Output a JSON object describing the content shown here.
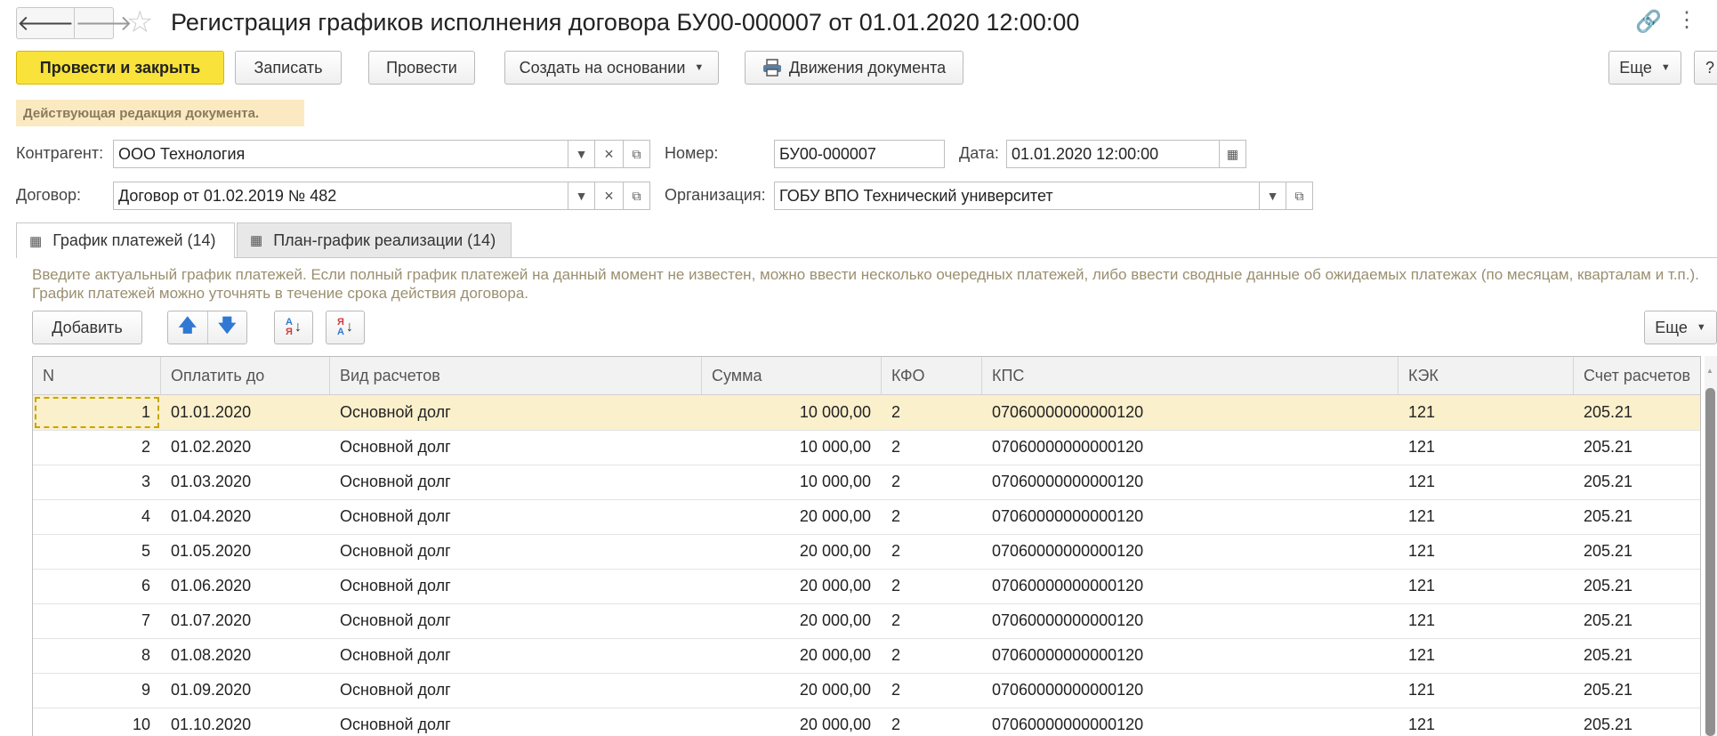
{
  "window": {
    "title": "Регистрация графиков исполнения договора БУ00-000007 от 01.01.2020 12:00:00",
    "back_icon": "arrow-left-icon",
    "forward_icon": "arrow-right-icon"
  },
  "toolbar": {
    "post_close": "Провести и закрыть",
    "save": "Записать",
    "post": "Провести",
    "create_based": "Создать на основании",
    "movements": "Движения документа",
    "more": "Еще",
    "help": "?"
  },
  "notice": "Действующая редакция документа.",
  "form": {
    "contractor_label": "Контрагент:",
    "contractor_value": "ООО Технология",
    "number_label": "Номер:",
    "number_value": "БУ00-000007",
    "date_label": "Дата:",
    "date_value": "01.01.2020 12:00:00",
    "contract_label": "Договор:",
    "contract_value": "Договор от 01.02.2019 № 482",
    "org_label": "Организация:",
    "org_value": "ГОБУ ВПО Технический университет"
  },
  "tabs": [
    {
      "label": "График платежей (14)"
    },
    {
      "label": "План-график реализации (14)"
    }
  ],
  "hint": "Введите актуальный график платежей. Если полный график платежей на данный момент не известен, можно ввести несколько очередных платежей, либо ввести сводные данные об ожидаемых платежах (по месяцам, кварталам и т.п.). График платежей можно уточнять в течение срока действия договора.",
  "table_toolbar": {
    "add": "Добавить",
    "more": "Еще",
    "sort_asc_top": "А",
    "sort_asc_bottom": "Я",
    "sort_desc_top": "Я",
    "sort_desc_bottom": "А"
  },
  "table": {
    "columns": [
      "N",
      "Оплатить до",
      "Вид расчетов",
      "Сумма",
      "КФО",
      "КПС",
      "КЭК",
      "Счет расчетов"
    ],
    "rows": [
      [
        "1",
        "01.01.2020",
        "Основной долг",
        "10 000,00",
        "2",
        "07060000000000120",
        "121",
        "205.21"
      ],
      [
        "2",
        "01.02.2020",
        "Основной долг",
        "10 000,00",
        "2",
        "07060000000000120",
        "121",
        "205.21"
      ],
      [
        "3",
        "01.03.2020",
        "Основной долг",
        "10 000,00",
        "2",
        "07060000000000120",
        "121",
        "205.21"
      ],
      [
        "4",
        "01.04.2020",
        "Основной долг",
        "20 000,00",
        "2",
        "07060000000000120",
        "121",
        "205.21"
      ],
      [
        "5",
        "01.05.2020",
        "Основной долг",
        "20 000,00",
        "2",
        "07060000000000120",
        "121",
        "205.21"
      ],
      [
        "6",
        "01.06.2020",
        "Основной долг",
        "20 000,00",
        "2",
        "07060000000000120",
        "121",
        "205.21"
      ],
      [
        "7",
        "01.07.2020",
        "Основной долг",
        "20 000,00",
        "2",
        "07060000000000120",
        "121",
        "205.21"
      ],
      [
        "8",
        "01.08.2020",
        "Основной долг",
        "20 000,00",
        "2",
        "07060000000000120",
        "121",
        "205.21"
      ],
      [
        "9",
        "01.09.2020",
        "Основной долг",
        "20 000,00",
        "2",
        "07060000000000120",
        "121",
        "205.21"
      ],
      [
        "10",
        "01.10.2020",
        "Основной долг",
        "20 000,00",
        "2",
        "07060000000000120",
        "121",
        "205.21"
      ]
    ]
  },
  "colors": {
    "accent": "#f9e33a",
    "selected_row": "#fbf0cc",
    "notice_bg": "#fbeac1",
    "sort_icon_blue": "#2f78d4",
    "sort_icon_red": "#d23b3b"
  }
}
